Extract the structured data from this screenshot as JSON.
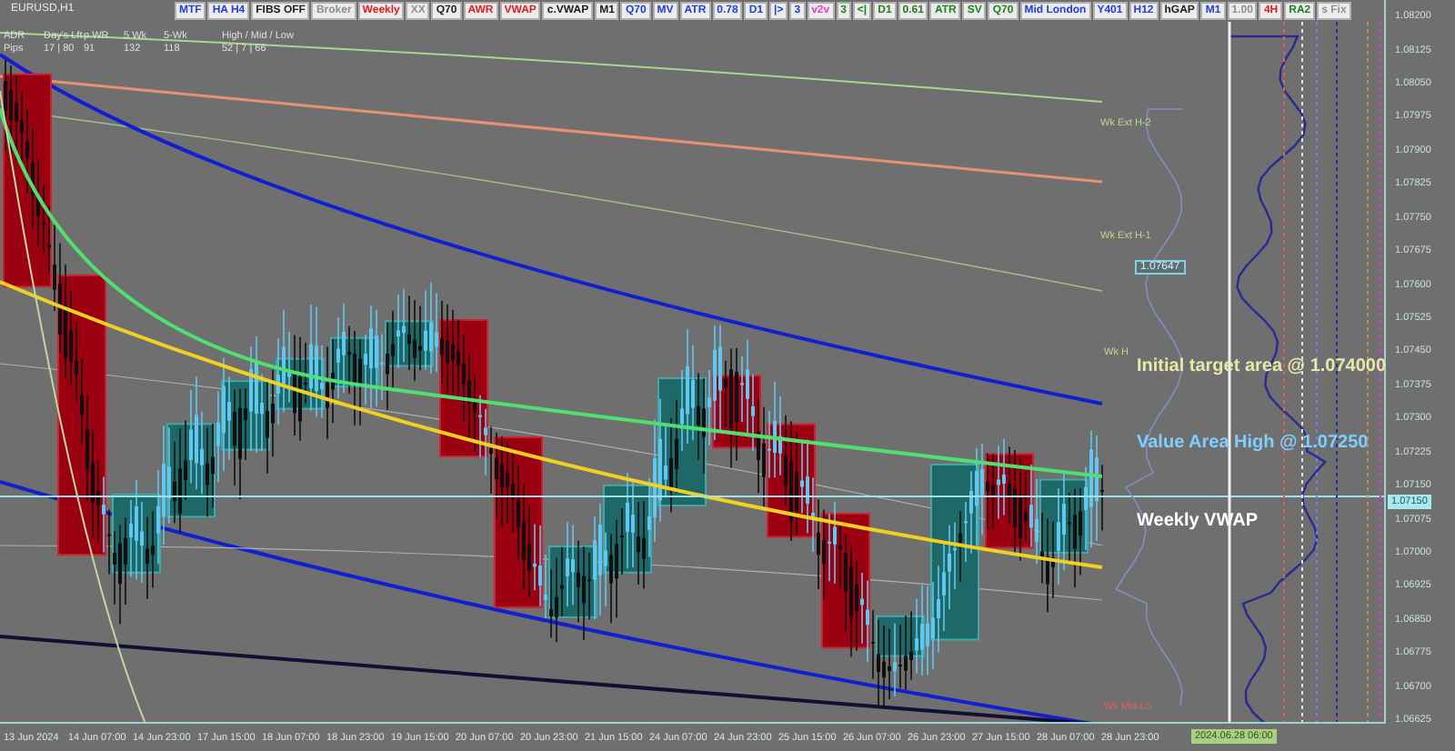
{
  "chart": {
    "symbol": "EURUSD,H1",
    "toolbar": [
      {
        "label": "MTF",
        "color": "#2040e0"
      },
      {
        "label": "HA H4",
        "color": "#2040e0"
      },
      {
        "label": "FIBS OFF",
        "color": "#202020"
      },
      {
        "label": "Broker",
        "color": "#909090"
      },
      {
        "label": "Weekly",
        "color": "#e02020"
      },
      {
        "label": "XX",
        "color": "#909090"
      },
      {
        "label": "Q70",
        "color": "#202020"
      },
      {
        "label": "AWR",
        "color": "#e02020"
      },
      {
        "label": "VWAP",
        "color": "#e02020"
      },
      {
        "label": "c.VWAP",
        "color": "#202020"
      },
      {
        "label": "M1",
        "color": "#202020"
      },
      {
        "label": "Q70",
        "color": "#2040e0"
      },
      {
        "label": "MV",
        "color": "#2040e0"
      },
      {
        "label": "ATR",
        "color": "#2040e0"
      },
      {
        "label": "0.78",
        "color": "#2040e0"
      },
      {
        "label": "D1",
        "color": "#2040e0"
      },
      {
        "label": "|>",
        "color": "#2040e0"
      },
      {
        "label": "3",
        "color": "#2040e0"
      },
      {
        "label": "v2v",
        "color": "#e040c0"
      },
      {
        "label": "3",
        "color": "#208020"
      },
      {
        "label": "<|",
        "color": "#208020"
      },
      {
        "label": "D1",
        "color": "#208020"
      },
      {
        "label": "0.61",
        "color": "#208020"
      },
      {
        "label": "ATR",
        "color": "#208020"
      },
      {
        "label": "SV",
        "color": "#208020"
      },
      {
        "label": "Q70",
        "color": "#208020"
      },
      {
        "label": "Mid London",
        "color": "#2040e0"
      },
      {
        "label": "Y401",
        "color": "#2040e0"
      },
      {
        "label": "H12",
        "color": "#2040e0"
      },
      {
        "label": "hGAP",
        "color": "#202020"
      },
      {
        "label": "M1",
        "color": "#2040e0"
      },
      {
        "label": "1.00",
        "color": "#909090"
      },
      {
        "label": "4H",
        "color": "#e02020"
      },
      {
        "label": "RA2",
        "color": "#208020"
      },
      {
        "label": "s Fix",
        "color": "#909090"
      }
    ],
    "info_panel": {
      "headers": [
        "ADR",
        "Day's Lft",
        "p.WR",
        "5 Wk",
        "5-Wk",
        "High / Mid / Low"
      ],
      "values": [
        "Pips",
        "17 | 80",
        "91",
        "132",
        "118",
        "52 | 7 | 66"
      ]
    },
    "level_labels": [
      {
        "text": "Wk Ext H-2",
        "color": "#c0d890"
      },
      {
        "text": "Wk Ext H-1",
        "color": "#c0d890"
      },
      {
        "text": "Wk H",
        "color": "#c0d890"
      },
      {
        "text": "Wk Mid Lo",
        "color": "#e06060"
      }
    ],
    "price_tag": "1.07647",
    "annotations": [
      {
        "text": "Initial target area @ 1.074000",
        "color": "#e8e8a8"
      },
      {
        "text": "Value Area High @ 1.07250",
        "color": "#7fd0ff"
      },
      {
        "text": "Weekly VWAP",
        "color": "#ffffff"
      }
    ],
    "price_axis": [
      "1.08200",
      "1.08125",
      "1.08050",
      "1.07975",
      "1.07900",
      "1.07825",
      "1.07750",
      "1.07675",
      "1.07600",
      "1.07525",
      "1.07450",
      "1.07375",
      "1.07300",
      "1.07225",
      "1.07150",
      "1.07075",
      "1.07000",
      "1.06925",
      "1.06850",
      "1.06775",
      "1.06700",
      "1.06625"
    ],
    "current_price": "1.07150",
    "time_axis": [
      "13 Jun 2024",
      "14 Jun 07:00",
      "14 Jun 23:00",
      "17 Jun 15:00",
      "18 Jun 07:00",
      "18 Jun 23:00",
      "19 Jun 15:00",
      "20 Jun 07:00",
      "20 Jun 23:00",
      "21 Jun 15:00",
      "24 Jun 07:00",
      "24 Jun 23:00",
      "25 Jun 15:00",
      "26 Jun 07:00",
      "26 Jun 23:00",
      "27 Jun 15:00",
      "28 Jun 07:00",
      "28 Jun 23:00"
    ],
    "cursor_time": "2024.06.28 06:00"
  }
}
